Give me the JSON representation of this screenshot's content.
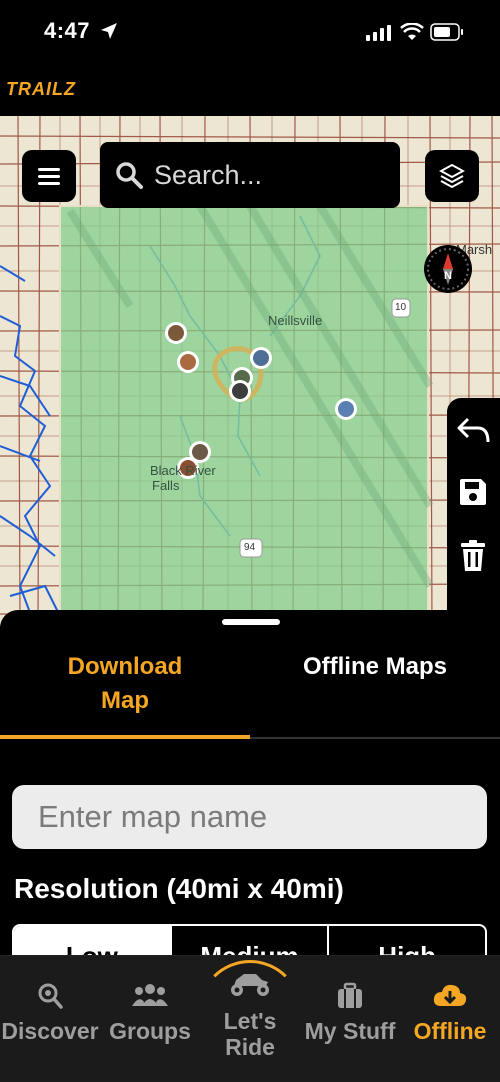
{
  "status_bar": {
    "time": "4:47"
  },
  "brand": {
    "logo_text": "TRAILZ"
  },
  "map": {
    "search_placeholder": "Search...",
    "town_labels": [
      "Neillsville",
      "Black River",
      "Falls"
    ],
    "highway_shields": [
      "10",
      "94"
    ],
    "edge_label": "Marsh",
    "compass_letter": "N"
  },
  "sheet": {
    "tabs": [
      {
        "label_line1": "Download",
        "label_line2": "Map",
        "active": true
      },
      {
        "label": "Offline Maps",
        "active": false
      }
    ],
    "map_name_placeholder": "Enter map name",
    "resolution_label": "Resolution (40mi x 40mi)",
    "resolution_options": [
      "Low",
      "Medium",
      "High"
    ],
    "selected_resolution": "Low"
  },
  "tabbar": {
    "items": [
      {
        "label": "Discover",
        "icon": "search-pin-icon",
        "active": false
      },
      {
        "label": "Groups",
        "icon": "group-icon",
        "active": false
      },
      {
        "label_line1": "Let's",
        "label_line2": "Ride",
        "icon": "atv-icon",
        "active": false
      },
      {
        "label": "My Stuff",
        "icon": "briefcase-icon",
        "active": false
      },
      {
        "label": "Offline",
        "icon": "cloud-download-icon",
        "active": true
      }
    ]
  },
  "colors": {
    "accent": "#f5a623",
    "overlay_green": "#7fcf8a",
    "background": "#000000",
    "tabbar": "#1b1b1b"
  }
}
